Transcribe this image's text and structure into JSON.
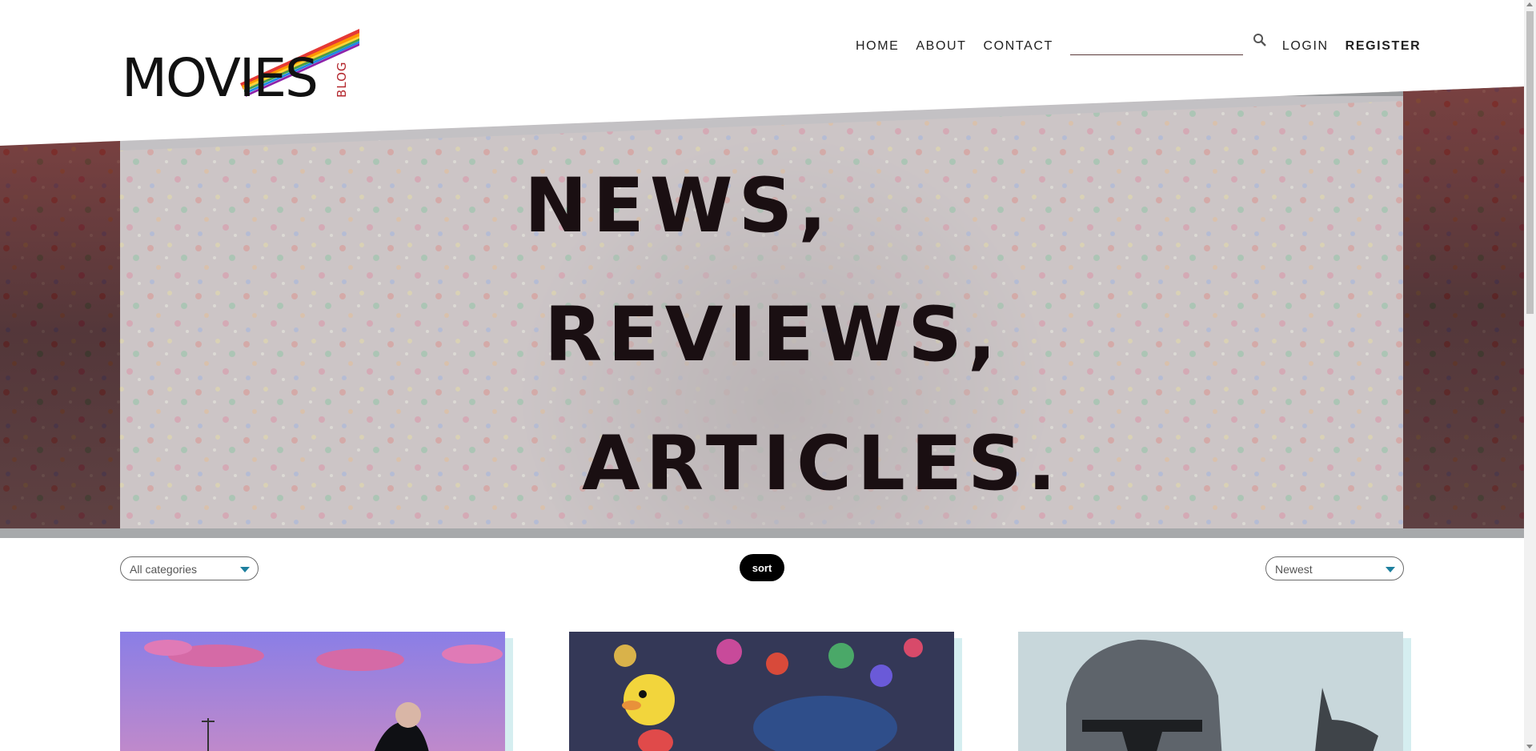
{
  "logo": {
    "main_text": "MOVIES",
    "sub_text": "BLOG"
  },
  "nav": {
    "home": "HOME",
    "about": "ABOUT",
    "contact": "CONTACT",
    "search_placeholder": "",
    "login": "LOGIN",
    "register": "REGISTER"
  },
  "hero": {
    "line1": "NEWS,",
    "line2": "REVIEWS,",
    "line3": "ARTICLES."
  },
  "filters": {
    "category_selected": "All categories",
    "sort_button": "sort",
    "order_selected": "Newest"
  },
  "cards": [
    {
      "image": "man-on-beach-purple-sky"
    },
    {
      "image": "duck-toy-carnival-wall"
    },
    {
      "image": "helmet-on-grey"
    }
  ],
  "colors": {
    "accent_caret": "#1d7f9e",
    "card_shadow": "#d5eef0",
    "hero_band": "#a7a9ab"
  }
}
